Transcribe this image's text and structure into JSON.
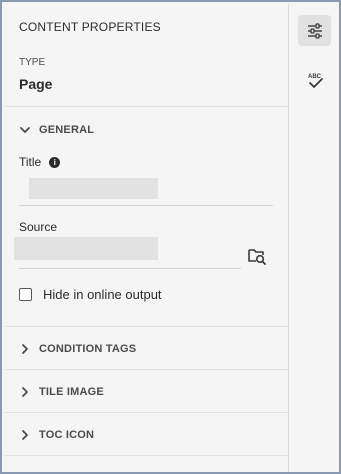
{
  "panel": {
    "title": "CONTENT PROPERTIES",
    "type_label": "TYPE",
    "type_value": "Page"
  },
  "general": {
    "header": "GENERAL",
    "expanded": true,
    "title_label": "Title",
    "title_value": "",
    "source_label": "Source",
    "source_value": "",
    "hide_online_label": "Hide in online output",
    "hide_online_checked": false
  },
  "sections": {
    "condition_tags": "CONDITION TAGS",
    "tile_image": "TILE IMAGE",
    "toc_icon": "TOC ICON"
  },
  "rail": {
    "properties_icon": "sliders-icon",
    "spellcheck_icon": "spellcheck-icon"
  },
  "colors": {
    "frame_border": "#8a9bb0",
    "panel_bg": "#f5f5f5",
    "text": "#2c2c2c"
  }
}
